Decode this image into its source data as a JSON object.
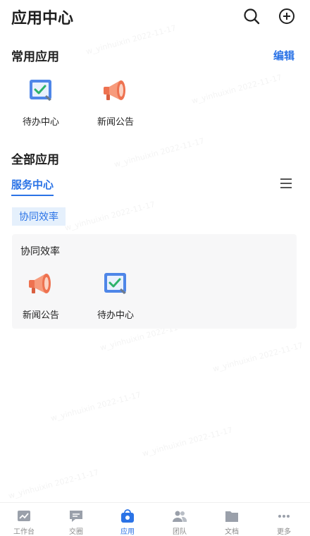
{
  "header": {
    "title": "应用中心"
  },
  "common": {
    "title": "常用应用",
    "edit_label": "编辑",
    "apps": [
      {
        "label": "待办中心",
        "icon": "todo-icon"
      },
      {
        "label": "新闻公告",
        "icon": "megaphone-icon"
      }
    ]
  },
  "all": {
    "title": "全部应用",
    "active_tab": "服务中心",
    "category_tag": "协同效率"
  },
  "card": {
    "title": "协同效率",
    "apps": [
      {
        "label": "新闻公告",
        "icon": "megaphone-icon"
      },
      {
        "label": "待办中心",
        "icon": "todo-icon"
      }
    ]
  },
  "watermark": {
    "text": "w_yinhuixin 2022-11-17"
  },
  "nav": {
    "items": [
      {
        "label": "工作台",
        "icon": "chart-icon"
      },
      {
        "label": "交圈",
        "icon": "chat-icon"
      },
      {
        "label": "应用",
        "icon": "app-bag-icon"
      },
      {
        "label": "团队",
        "icon": "team-icon"
      },
      {
        "label": "文档",
        "icon": "folder-icon"
      },
      {
        "label": "更多",
        "icon": "more-icon"
      }
    ]
  },
  "colors": {
    "accent": "#2b73e6",
    "megaphone": "#f07a55"
  }
}
